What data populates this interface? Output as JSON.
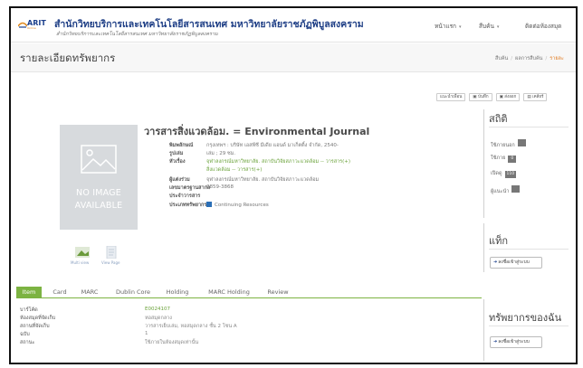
{
  "header": {
    "logo_text": "ARIT",
    "logo_sub": "Online",
    "title": "สำนักวิทยบริการและเทคโนโลยีสารสนเทศ มหาวิทยาลัยราชภัฏพิบูลสงคราม",
    "subtitle": "สำนักวิทยบริการและเทคโนโลยีสารสนเทศ มหาวิทยาลัยราชภัฏพิบูลสงคราม",
    "nav": [
      {
        "label": "หน้าแรก",
        "caret": "▾"
      },
      {
        "label": "สืบค้น",
        "caret": "▾"
      },
      {
        "label": "ติดต่อห้องสมุด",
        "caret": ""
      }
    ]
  },
  "page": {
    "title": "รายละเอียดทรัพยากร",
    "breadcrumb": [
      "สืบค้น",
      "ผลการสืบค้น",
      "รายละ"
    ]
  },
  "actions": [
    "แนะนำเพื่อน",
    "บันทึก",
    "ส่งออก",
    "เคลียร์"
  ],
  "cover": {
    "line1": "NO IMAGE",
    "line2": "AVAILABLE"
  },
  "views": [
    "Multi view",
    "View Page"
  ],
  "record": {
    "title": "วารสารสิ่งแวดล้อม. = Environmental Journal",
    "fields": [
      {
        "key": "พิมพลักษณ์",
        "value": "กรุงเทพฯ : บริษัท เอสพีซี มีเดีย แอนด์ มาเก็ตติ้ง จำกัด, 2540-",
        "link": false
      },
      {
        "key": "รูปเล่ม",
        "value": "เล่ม ; 29 ซม.",
        "link": false
      },
      {
        "key": "หัวเรื่อง",
        "value": "จุฬาลงกรณ์มหาวิทยาลัย. สถาบันวิจัยสภาวะแวดล้อม -- วารสาร(+)",
        "link": true
      },
      {
        "key": "",
        "value": "สิ่งแวดล้อม -- วารสาร(+)",
        "link": true
      },
      {
        "key": "ผู้แต่งร่วม",
        "value": "จุฬาลงกรณ์มหาวิทยาลัย. สถาบันวิจัยสภาวะแวดล้อม",
        "link": false
      },
      {
        "key": "เลขมาตรฐานสากล",
        "value": "0859-3868",
        "link": false
      },
      {
        "key": "ประจำวารสาร",
        "value": "",
        "link": false
      },
      {
        "key": "ประเภททรัพยากร",
        "value": "Continuing Resources",
        "link": false
      }
    ]
  },
  "tabs": [
    "Item",
    "Card",
    "MARC",
    "Dublin Core",
    "Holding",
    "MARC Holding",
    "Review"
  ],
  "holdings": [
    {
      "key": "บาร์โค้ด",
      "value": "E0024107",
      "link": true
    },
    {
      "key": "ห้องสมุดที่จัดเก็บ",
      "value": "หอสมุดกลาง",
      "link": false
    },
    {
      "key": "สถานที่จัดเก็บ",
      "value": "วารสารเย็บเล่ม, หอสมุดกลาง ชั้น 2 โซน A",
      "link": false
    },
    {
      "key": "ฉบับ",
      "value": "1",
      "link": false
    },
    {
      "key": "สถานะ",
      "value": "ใช้ภายในห้องสมุดเท่านั้น",
      "link": false
    }
  ],
  "sidebar": {
    "stats_title": "สถิติ",
    "stats": [
      {
        "label": "ใช้ภายนอก",
        "count": ""
      },
      {
        "label": "ใช้ภาย",
        "count": "0"
      },
      {
        "label": "เปิดดู",
        "count": "110"
      },
      {
        "label": "ผู้แนะนำ",
        "count": ""
      }
    ],
    "tags_title": "แท็ก",
    "mine_title": "ทรัพยากรของฉัน",
    "login_label": "ลงชื่อเข้าสู่ระบบ"
  }
}
